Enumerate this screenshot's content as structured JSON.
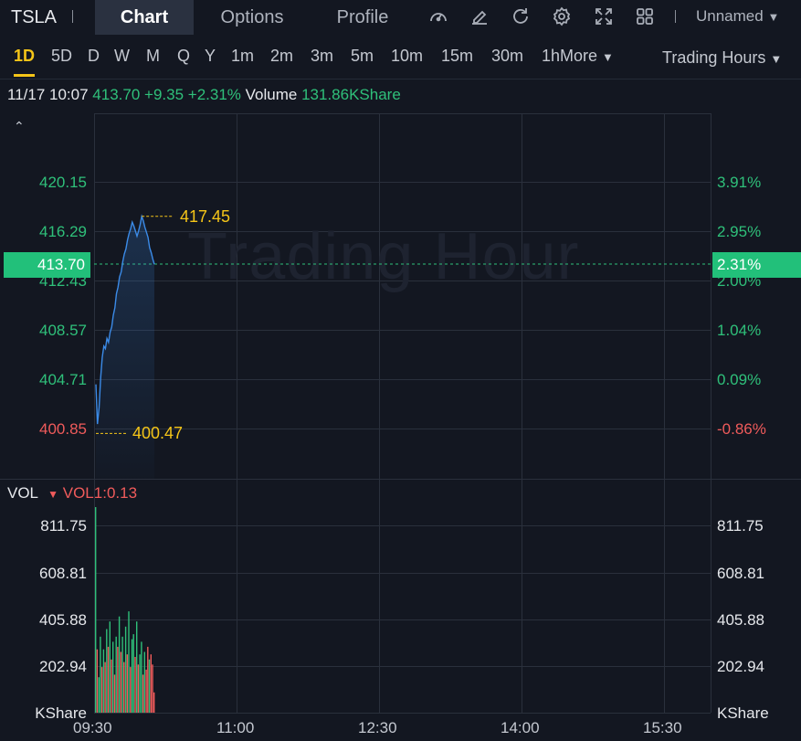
{
  "topbar": {
    "symbol": "TSLA",
    "tabs": [
      "Chart",
      "Options",
      "Profile"
    ],
    "active_tab": "Chart",
    "icons": [
      "gauge-icon",
      "draw-icon",
      "refresh-icon",
      "settings-icon",
      "fullscreen-icon",
      "layout-grid-icon"
    ],
    "layout_name": "Unnamed"
  },
  "periods": {
    "items": [
      "1D",
      "5D",
      "D",
      "W",
      "M",
      "Q",
      "Y",
      "1m",
      "2m",
      "3m",
      "5m",
      "10m",
      "15m",
      "30m",
      "1h"
    ],
    "active": "1D",
    "more_label": "More",
    "session_label": "Trading Hours"
  },
  "quote": {
    "datetime": "11/17 10:07",
    "price": "413.70",
    "change": "+9.35",
    "change_pct": "+2.31%",
    "volume_label": "Volume",
    "volume_value": "131.86KShare"
  },
  "price_panel": {
    "left_labels": [
      "420.15",
      "416.29",
      "412.43",
      "408.57",
      "404.71",
      "400.85"
    ],
    "right_labels": [
      "3.91%",
      "2.95%",
      "2.00%",
      "1.04%",
      "0.09%",
      "-0.86%"
    ],
    "current_price": "413.70",
    "current_pct": "2.31%",
    "high_label": "417.45",
    "low_label": "400.47",
    "watermark": "Trading Hour"
  },
  "volume_panel": {
    "indicator": "VOL",
    "indicator_value": "VOL1:0.13",
    "labels": [
      "811.75",
      "608.81",
      "405.88",
      "202.94",
      "KShare"
    ],
    "unit": "KShare"
  },
  "x_axis": [
    "09:30",
    "11:00",
    "12:30",
    "14:00",
    "15:30"
  ],
  "chart_data": {
    "type": "line",
    "title": "",
    "xlabel": "",
    "ylabel": "",
    "ylim": [
      400.0,
      421.0
    ],
    "x": [
      "09:30",
      "09:31",
      "09:32",
      "09:33",
      "09:34",
      "09:35",
      "09:36",
      "09:37",
      "09:38",
      "09:39",
      "09:40",
      "09:41",
      "09:42",
      "09:43",
      "09:44",
      "09:45",
      "09:46",
      "09:47",
      "09:48",
      "09:49",
      "09:50",
      "09:51",
      "09:52",
      "09:53",
      "09:54",
      "09:55",
      "09:56",
      "09:57",
      "09:58",
      "09:59",
      "10:00",
      "10:01",
      "10:02",
      "10:03",
      "10:04",
      "10:05",
      "10:06",
      "10:07"
    ],
    "series": [
      {
        "values": [
          404.3,
          401.2,
          402.5,
          404.8,
          406.4,
          407.3,
          407.1,
          407.9,
          407.6,
          408.4,
          408.8,
          409.7,
          410.3,
          411.4,
          411.9,
          412.7,
          413.1,
          413.9,
          414.5,
          414.9,
          415.6,
          416.1,
          416.5,
          417.0,
          416.7,
          416.3,
          415.9,
          416.3,
          416.8,
          417.45,
          417.1,
          416.6,
          416.2,
          415.8,
          415.0,
          414.6,
          414.1,
          413.7
        ]
      }
    ],
    "volume": {
      "unit": "KShare",
      "ylim": [
        0,
        811.75
      ],
      "values": [
        811.75,
        250,
        140,
        300,
        180,
        250,
        200,
        330,
        260,
        360,
        210,
        280,
        150,
        300,
        260,
        380,
        240,
        300,
        200,
        340,
        230,
        400,
        180,
        290,
        310,
        220,
        360,
        190,
        230,
        280,
        150,
        240,
        170,
        260,
        210,
        230,
        190,
        80
      ],
      "up": [
        true,
        false,
        true,
        true,
        false,
        true,
        false,
        true,
        false,
        true,
        false,
        true,
        false,
        true,
        false,
        true,
        false,
        true,
        false,
        true,
        false,
        true,
        false,
        true,
        true,
        false,
        true,
        false,
        true,
        true,
        false,
        true,
        false,
        false,
        true,
        false,
        false,
        false
      ]
    },
    "price_axis": [
      420.15,
      416.29,
      412.43,
      408.57,
      404.71,
      400.85
    ],
    "grid": true
  },
  "colors": {
    "up": "#2fc07a",
    "down": "#f05b5b",
    "line": "#3b8be8",
    "accent": "#f5c518",
    "background": "#131721"
  }
}
